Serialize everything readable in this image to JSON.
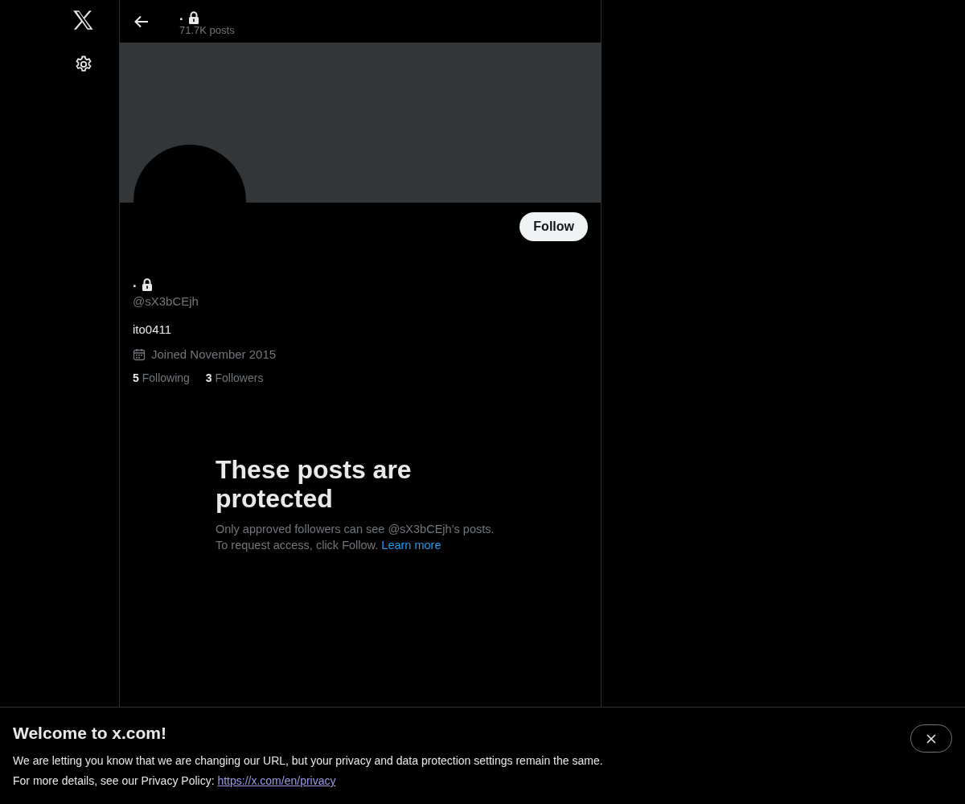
{
  "header": {
    "name": ".",
    "locked": true,
    "post_count": "71.7K posts"
  },
  "profile": {
    "follow_button": "Follow",
    "name": ".",
    "locked": true,
    "handle": "@sX3bCEjh",
    "bio": "ito0411",
    "joined": "Joined November 2015",
    "stats": [
      {
        "count": "5",
        "label": "Following"
      },
      {
        "count": "3",
        "label": "Followers"
      }
    ]
  },
  "protected_notice": {
    "title": "These posts are protected",
    "text": "Only approved followers can see @sX3bCEjh’s posts. To request access, click Follow.",
    "link": "Learn more"
  },
  "banner": {
    "title": "Welcome to x.com!",
    "line_1": "We are letting you know that we are changing our URL, but your privacy and data protection settings remain the same.",
    "line_2": "For more details, see our Privacy Policy:",
    "link": "https://x.com/en/privacy"
  }
}
